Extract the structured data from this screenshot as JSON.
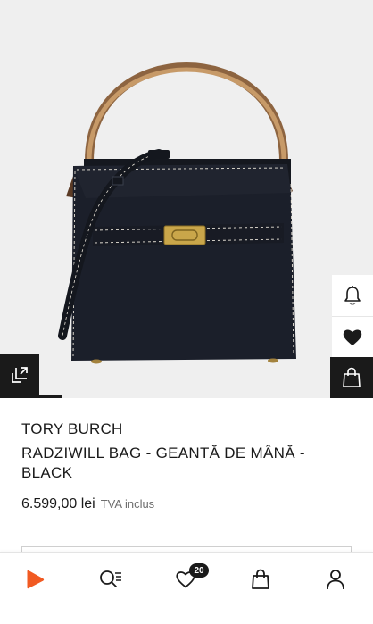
{
  "product": {
    "brand": "TORY BURCH",
    "name": "RADZIWILL BAG - GEANTĂ DE MÂNĂ - BLACK",
    "price": "6.599,00 lei",
    "tax_note": "TVA inclus"
  },
  "image_actions": {
    "notify_icon": "bell-icon",
    "wishlist_icon": "heart-filled-icon",
    "bag_icon": "shopping-bag-icon",
    "view_icon": "expand-view-icon"
  },
  "bottom_nav": {
    "items": [
      {
        "name": "home",
        "icon": "brand-logo-icon"
      },
      {
        "name": "search",
        "icon": "search-list-icon"
      },
      {
        "name": "wishlist",
        "icon": "heart-outline-icon",
        "badge": "20"
      },
      {
        "name": "cart",
        "icon": "shopping-bag-icon"
      },
      {
        "name": "account",
        "icon": "user-icon"
      }
    ]
  },
  "colors": {
    "brand_accent": "#f15a22",
    "ink": "#1a1a1a",
    "image_background": "#efefef",
    "bag_body": "#1b1f2a",
    "handle": "#b98a5a",
    "hardware": "#c9a64a"
  }
}
